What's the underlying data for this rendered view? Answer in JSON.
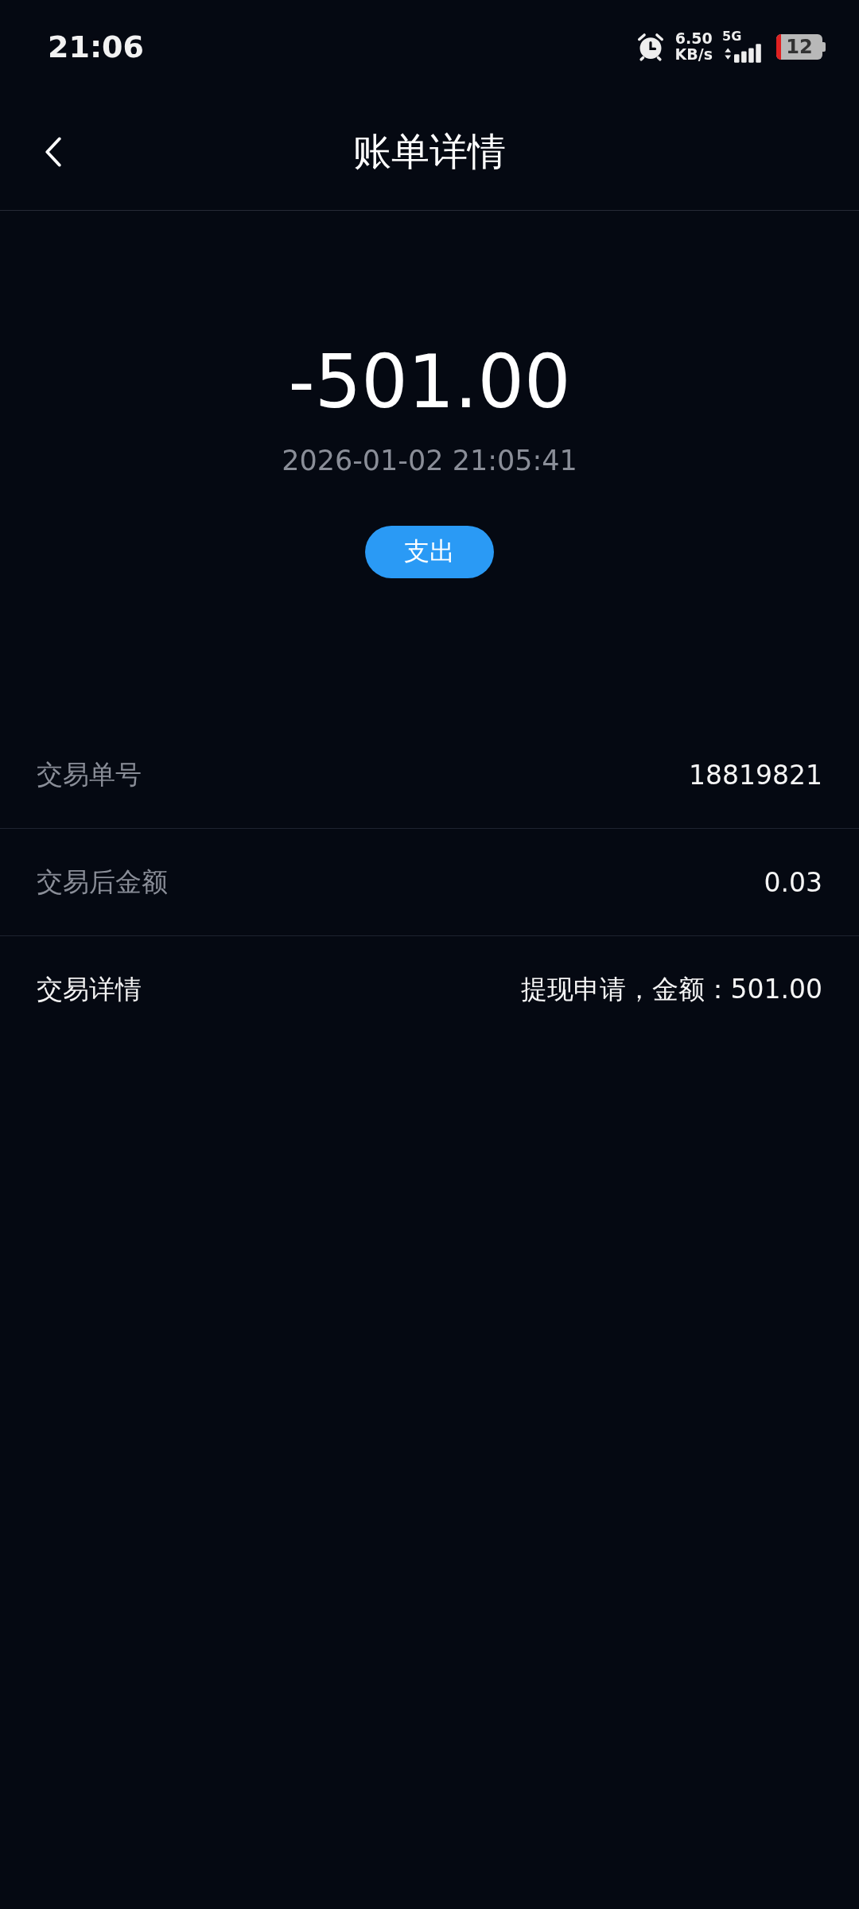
{
  "status_bar": {
    "time": "21:06",
    "speed_value": "6.50",
    "speed_unit": "KB/s",
    "network": "5G",
    "battery": "12"
  },
  "header": {
    "title": "账单详情"
  },
  "summary": {
    "amount": "-501.00",
    "datetime": "2026-01-02 21:05:41",
    "type_badge": "支出"
  },
  "details": [
    {
      "label": "交易单号",
      "value": "18819821",
      "emphasized": false
    },
    {
      "label": "交易后金额",
      "value": "0.03",
      "emphasized": false
    },
    {
      "label": "交易详情",
      "value": "提现申请，金额：501.00",
      "emphasized": true
    }
  ]
}
